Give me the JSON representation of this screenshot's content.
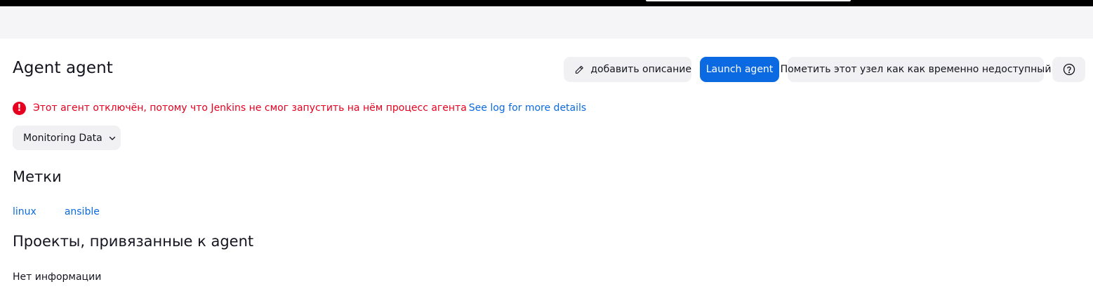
{
  "header": {
    "title": "Agent agent"
  },
  "toolbar": {
    "add_description_label": "добавить описание",
    "launch_agent_label": "Launch agent",
    "mark_offline_label": "Пометить этот узел как как временно недоступный",
    "help_icon": "question-circle-icon",
    "edit_icon": "pencil-icon"
  },
  "status": {
    "icon": "exclamation-circle-icon",
    "error_message": "Этот агент отключён, потому что Jenkins не смог запустить на нём процесс агента",
    "log_link": "See log for more details"
  },
  "monitoring": {
    "label": "Monitoring Data",
    "icon": "chevron-down-icon"
  },
  "labels_section": {
    "heading": "Метки",
    "items": [
      "linux",
      "ansible"
    ]
  },
  "projects_section": {
    "heading": "Проекты, привязанные к agent",
    "empty_text": "Нет информации"
  },
  "colors": {
    "accent": "#0b6ae1",
    "error": "#e6001f",
    "button_bg": "#f1f1f3",
    "breadcrumb_bg": "#f5f5f7"
  }
}
